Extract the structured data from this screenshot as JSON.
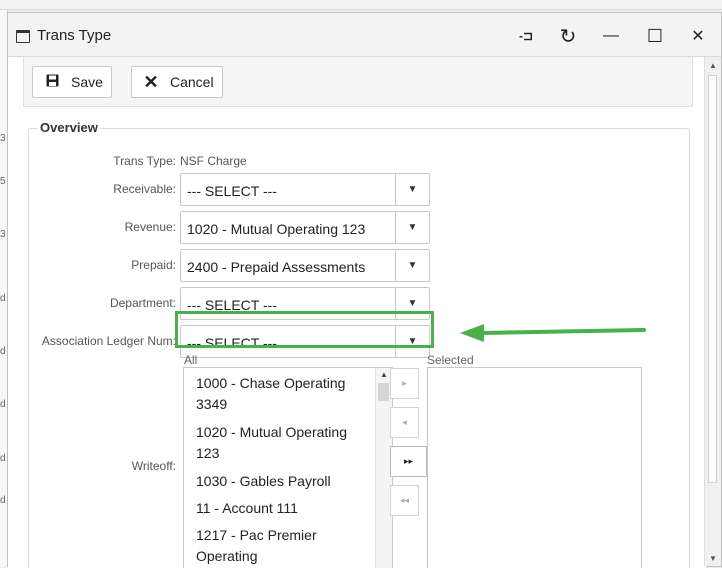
{
  "window": {
    "title": "Trans Type",
    "controls": {
      "pin": "-⊐",
      "refresh": "↻",
      "minimize": "—",
      "maximize": "☐",
      "close": "✕"
    }
  },
  "toolbar": {
    "save_label": "Save",
    "cancel_label": "Cancel"
  },
  "overview": {
    "legend": "Overview",
    "trans_type_label": "Trans Type:",
    "trans_type_value": "NSF Charge",
    "receivable_label": "Receivable:",
    "receivable_value": "--- SELECT ---",
    "revenue_label": "Revenue:",
    "revenue_value": "1020 - Mutual Operating 123",
    "prepaid_label": "Prepaid:",
    "prepaid_value": "2400 - Prepaid Assessments",
    "department_label": "Department:",
    "department_value": "--- SELECT ---",
    "assoc_ledger_label": "Association Ledger Num:",
    "assoc_ledger_value": "--- SELECT ---",
    "writeoff_label": "Writeoff:"
  },
  "writeoff": {
    "all_label": "All",
    "selected_label": "Selected",
    "all_items": [
      "1000 - Chase Operating 3349",
      "1020 - Mutual Operating 123",
      "1030 - Gables Payroll",
      "11 - Account 111",
      "1217 - Pac Premier Operating"
    ],
    "buttons": {
      "move_right": "▸",
      "move_left": "◂",
      "move_all_right": "▸▸",
      "move_all_left": "◂◂"
    }
  },
  "left_peek": [
    "3",
    "5",
    "3",
    "d",
    "d",
    "d",
    "d",
    "d"
  ],
  "colors": {
    "highlight": "#4cae4c"
  }
}
